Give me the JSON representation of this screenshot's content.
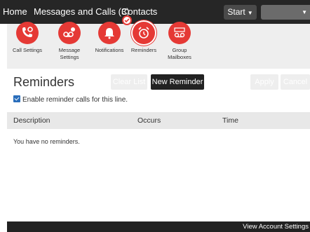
{
  "nav": {
    "home": "Home",
    "messages": "Messages and Calls (3)",
    "contacts": "Contacts",
    "start": "Start"
  },
  "toolbar": {
    "items": [
      {
        "label": "Call Settings",
        "icon": "phone-gear-icon"
      },
      {
        "label": "Message Settings",
        "icon": "voicemail-gear-icon"
      },
      {
        "label": "Notifications",
        "icon": "bell-icon"
      },
      {
        "label": "Reminders",
        "icon": "alarm-clock-icon"
      },
      {
        "label": "Group Mailboxes",
        "icon": "group-voicemail-icon"
      }
    ],
    "active": "Reminders"
  },
  "page": {
    "title": "Reminders",
    "clear_list": "Clear List",
    "new_reminder": "New Reminder",
    "apply": "Apply",
    "cancel": "Cancel",
    "enable_label": "Enable reminder calls for this line.",
    "enable_checked": true
  },
  "table": {
    "columns": [
      "Description",
      "Occurs",
      "Time"
    ],
    "empty_message": "You have no reminders."
  },
  "footer": {
    "link": "View Account Settings"
  },
  "colors": {
    "accent": "#e53935",
    "nav_bg": "#262626",
    "toolbar_bg": "#eeeeee"
  }
}
